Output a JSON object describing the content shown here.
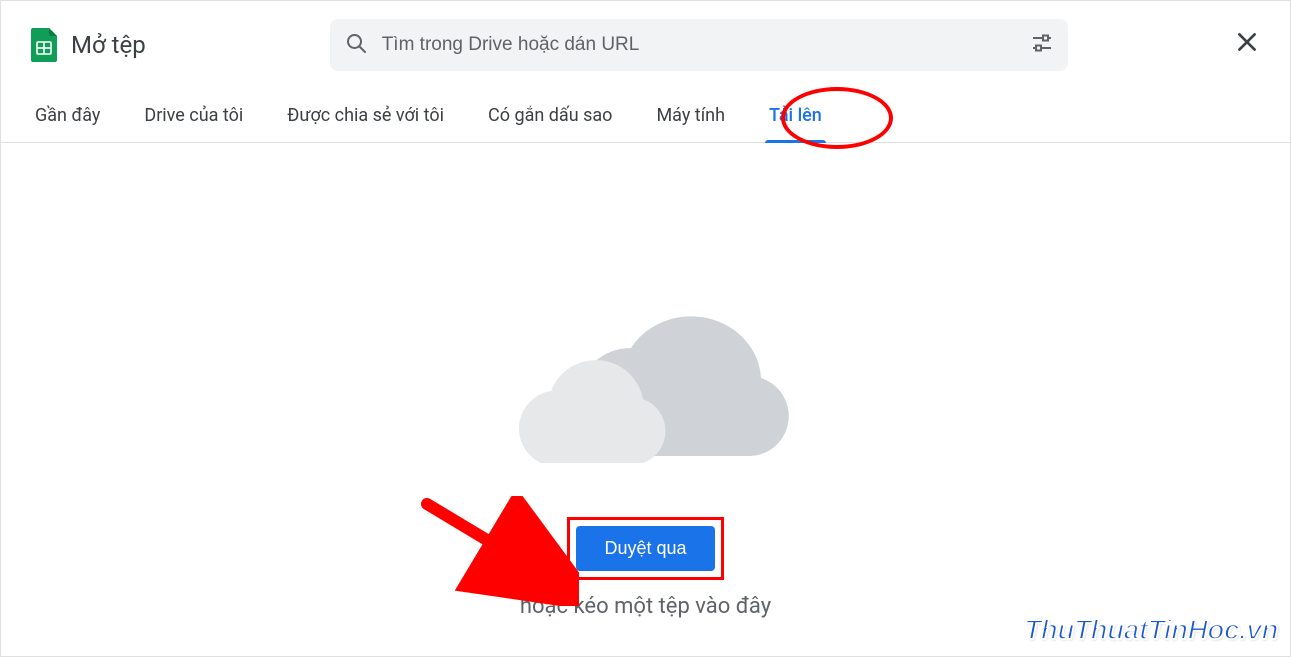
{
  "header": {
    "title": "Mở tệp",
    "search_placeholder": "Tìm trong Drive hoặc dán URL"
  },
  "tabs": [
    {
      "label": "Gần đây",
      "active": false
    },
    {
      "label": "Drive của tôi",
      "active": false
    },
    {
      "label": "Được chia sẻ với tôi",
      "active": false
    },
    {
      "label": "Có gắn dấu sao",
      "active": false
    },
    {
      "label": "Máy tính",
      "active": false
    },
    {
      "label": "Tải lên",
      "active": true
    }
  ],
  "upload": {
    "browse_label": "Duyệt qua",
    "drag_text": "hoặc kéo một tệp vào đây"
  },
  "annotations": {
    "highlight_tab_index": 5,
    "arrow_points_to": "browse-button"
  },
  "watermark": "ThuThuatTinHoc.vn",
  "colors": {
    "accent": "#1a73e8",
    "annotation": "#ff0000",
    "text_muted": "#5f6368"
  }
}
